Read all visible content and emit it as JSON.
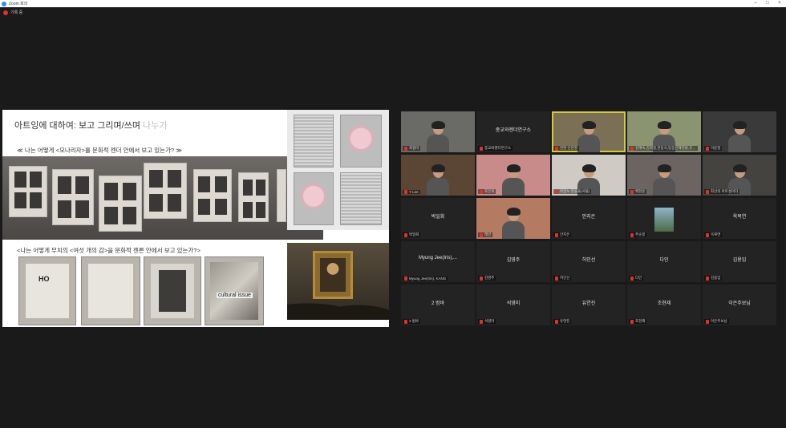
{
  "window": {
    "title": "Zoom 회의",
    "recording_label": "기록 중"
  },
  "slide": {
    "title_main": "아트잉에 대하여: 보고 그리며/쓰며 ",
    "title_dim": "나누기",
    "question1": "≪ 나는 어떻게 <모나리자>를 문화적 젠더 안에서 보고 있는가? ≫",
    "question2": "<나는 어떻게 무치의 <여섯 개의 감>을 문화적 젠른 안에서 보고 있는가?>",
    "art_labels": {
      "ho": "HO",
      "cultural": "cultural issue"
    }
  },
  "participants": [
    {
      "name": "최형미",
      "display": "",
      "video": true
    },
    {
      "name": "종교와젠더연구소",
      "display": "종교와젠더연구소",
      "video": false
    },
    {
      "name": "현완 신현경",
      "display": "",
      "video": true,
      "active": true
    },
    {
      "name": "김혜숙,김희정,한동식,등동인재영물,유…",
      "display": "",
      "video": true
    },
    {
      "name": "이윤정",
      "display": "",
      "video": true
    },
    {
      "name": "Y Lee",
      "display": "",
      "video": true
    },
    {
      "name": "조은희",
      "display": "",
      "video": true
    },
    {
      "name": "박일누 한을율(서울)",
      "display": "",
      "video": true
    },
    {
      "name": "백현운",
      "display": "",
      "video": true
    },
    {
      "name": "최선의 아토성이다",
      "display": "",
      "video": true
    },
    {
      "name": "박일화",
      "display": "박일화",
      "video": false
    },
    {
      "name": "래인",
      "display": "",
      "video": true
    },
    {
      "name": "안지은",
      "display": "안지은",
      "video": false
    },
    {
      "name": "주순봉",
      "display": "",
      "video": false,
      "photo": true
    },
    {
      "name": "옥복연",
      "display": "옥복연",
      "video": false
    },
    {
      "name": "Myung Jee(Iris), KANG",
      "display": "Myung  Jee(Iris),...",
      "video": false
    },
    {
      "name": "김영주",
      "display": "김영주",
      "video": false
    },
    {
      "name": "허인선",
      "display": "허인선",
      "video": false
    },
    {
      "name": "다인",
      "display": "다인",
      "video": false
    },
    {
      "name": "김용임",
      "display": "김용임",
      "video": false
    },
    {
      "name": "2 범바",
      "display": "2 범바",
      "video": false
    },
    {
      "name": "석영미",
      "display": "석영미",
      "video": false
    },
    {
      "name": "유연진",
      "display": "유연진",
      "video": false
    },
    {
      "name": "조현제",
      "display": "조현제",
      "video": false
    },
    {
      "name": "이은주보님",
      "display": "이은주보님",
      "video": false
    }
  ]
}
